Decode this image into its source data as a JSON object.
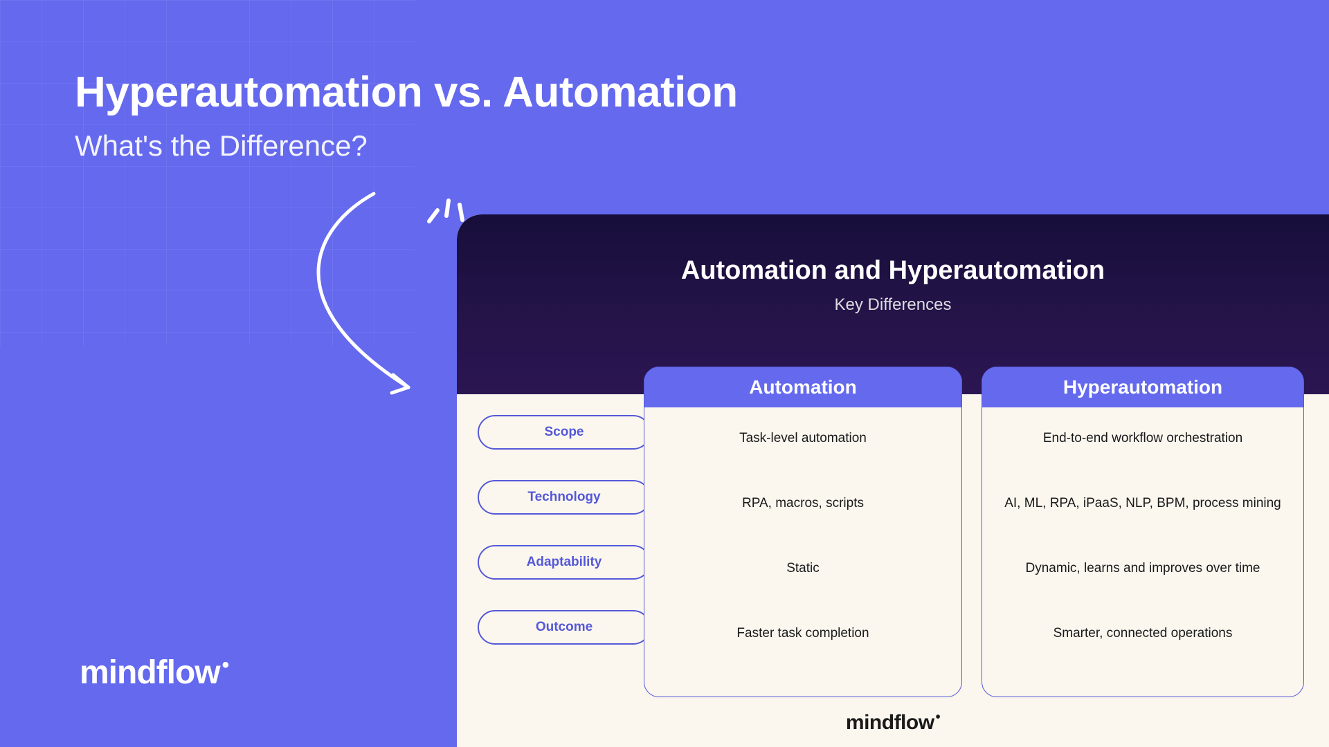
{
  "header": {
    "title": "Hyperautomation vs. Automation",
    "subtitle": "What's the Difference?"
  },
  "brand": "mindflow",
  "panel": {
    "title": "Automation and Hyperautomation",
    "subtitle": "Key Differences",
    "row_labels": [
      "Scope",
      "Technology",
      "Adaptability",
      "Outcome"
    ],
    "columns": [
      {
        "name": "Automation",
        "cells": [
          "Task-level automation",
          "RPA, macros, scripts",
          "Static",
          "Faster task completion"
        ]
      },
      {
        "name": "Hyperautomation",
        "cells": [
          "End-to-end workflow orchestration",
          "AI, ML, RPA, iPaaS, NLP, BPM, process mining",
          "Dynamic, learns and improves over time",
          "Smarter, connected operations"
        ]
      }
    ],
    "brand": "mindflow"
  },
  "chart_data": {
    "type": "table",
    "title": "Automation and Hyperautomation — Key Differences",
    "columns": [
      "",
      "Automation",
      "Hyperautomation"
    ],
    "rows": [
      [
        "Scope",
        "Task-level automation",
        "End-to-end workflow orchestration"
      ],
      [
        "Technology",
        "RPA, macros, scripts",
        "AI, ML, RPA, iPaaS, NLP, BPM, process mining"
      ],
      [
        "Adaptability",
        "Static",
        "Dynamic, learns and improves over time"
      ],
      [
        "Outcome",
        "Faster task completion",
        "Smarter, connected operations"
      ]
    ]
  }
}
